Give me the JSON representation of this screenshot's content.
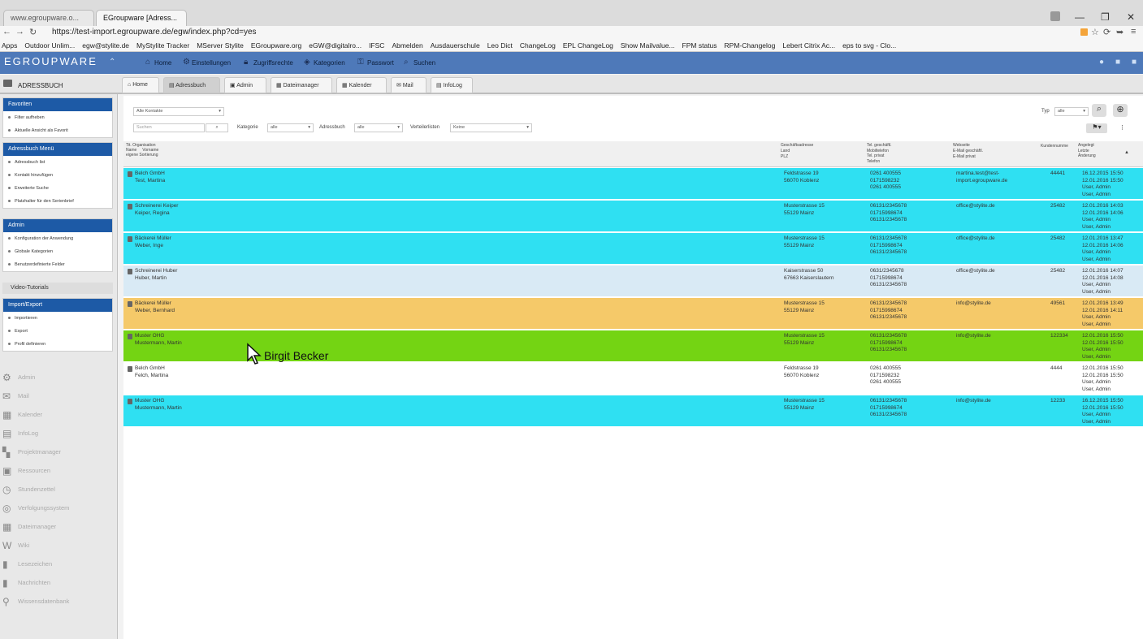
{
  "browser": {
    "tabs": [
      "www.egroupware.o...",
      "EGroupware [Adress..."
    ],
    "url": "https://test-import.egroupware.de/egw/index.php?cd=yes",
    "bookmarks": [
      "Apps",
      "Outdoor Unlim...",
      "egw@stylite.de",
      "MyStylite Tracker",
      "MServer Stylite",
      "EGroupware.org",
      "eGW@digitalro...",
      "IFSC",
      "Abmelden",
      "Ausdauerschule",
      "Leo Dict",
      "ChangeLog",
      "EPL ChangeLog",
      "Show Mailvalue...",
      "FPM status",
      "RPM-Changelog",
      "Lebert Citrix Ac...",
      "eps to svg - Clo..."
    ]
  },
  "topbar": {
    "logo": "EGROUPWARE",
    "nav": [
      "Home",
      "Einstellungen",
      "Zugriffsrechte",
      "Kategorien",
      "Passwort",
      "Suchen"
    ]
  },
  "app": {
    "title": "ADRESSBUCH",
    "tabs": [
      "Home",
      "Adressbuch",
      "Admin",
      "Dateimanager",
      "Kalender",
      "Mail",
      "InfoLog"
    ]
  },
  "sidebar": {
    "favoriten": {
      "header": "Favoriten",
      "items": [
        "Filter aufheben",
        "Aktuelle Ansicht als Favorit"
      ]
    },
    "menu": {
      "header": "Adressbuch Menü",
      "items": [
        "Adressbuch list",
        "Kontakt hinzufügen",
        "Erweiterte Suche",
        "Platzhalter für den Serienbrief"
      ]
    },
    "admin": {
      "header": "Admin",
      "items": [
        "Konfiguration der Anwendung",
        "Globale Kategorien",
        "Benutzerdefinierte Felder"
      ]
    },
    "video": "Video-Tutorials",
    "impexp": {
      "header": "Import/Export",
      "items": [
        "Importieren",
        "Export",
        "Profil definieren"
      ]
    },
    "apps": [
      "Admin",
      "Mail",
      "Kalender",
      "InfoLog",
      "Projektmanager",
      "Ressourcen",
      "Stundenzettel",
      "Verfolgungssystem",
      "Dateimanager",
      "Wiki",
      "Lesezeichen",
      "Nachrichten",
      "Wissensdatenbank"
    ]
  },
  "filters": {
    "view": "Alle Kontakte",
    "search_placeholder": "Suchen",
    "kategorie_label": "Kategorie",
    "kategorie_value": "alle",
    "adressbuch_label": "Adressbuch",
    "adressbuch_value": "alle",
    "verteiler_label": "Verteilerlisten",
    "verteiler_value": "Keine",
    "typ_label": "Typ",
    "typ_value": "alle"
  },
  "columns": {
    "name": "Tit. Organisation\nName     Vorname\neigene Sortierung",
    "address": "Geschäftsadresse\nLand\nPLZ",
    "phone": "Tel. geschäftl.\nMobiltelefon\nTel. privat\nTelefon",
    "web": "Webseite\nE-Mail geschäftl.\nE-Mail privat",
    "custno": "Kundennumme",
    "modified": "Angelegt\nLetzte\nÄnderung"
  },
  "colors": {
    "cyan": "#2fe0f2",
    "lightblue": "#d9eaf5",
    "orange": "#f5c969",
    "green": "#74d413",
    "white": "#ffffff"
  },
  "rows": [
    {
      "color": "cyan",
      "name": "Belch GmbH\nTest, Martina",
      "address": "Feldstrasse 19\n56070 Koblenz",
      "phone": "0261 400555\n0171598232\n0261 400555",
      "web": "martina.test@test-\nimport.egroupware.de",
      "custno": "44441",
      "modified": "16.12.2015 15:50\n12.01.2016 15:50\nUser, Admin\nUser, Admin"
    },
    {
      "color": "cyan",
      "name": "Schreinerei Keiper\nKeiper, Regina",
      "address": "Musterstrasse 15\n55129 Mainz",
      "phone": "06131/2345678\n01715998674\n06131/2345678",
      "web": "office@stylite.de",
      "custno": "25482",
      "modified": "12.01.2016 14:03\n12.01.2016 14:06\nUser, Admin\nUser, Admin"
    },
    {
      "color": "cyan",
      "name": "Bäckerei Müller\nWeber, Inge",
      "address": "Musterstrasse 15\n55129 Mainz",
      "phone": "06131/2345678\n01715998674\n06131/2345678",
      "web": "office@stylite.de",
      "custno": "25482",
      "modified": "12.01.2016 13:47\n12.01.2016 14:06\nUser, Admin\nUser, Admin"
    },
    {
      "color": "lightblue",
      "name": "Schreinerei Huber\nHuber, Martin",
      "address": "Kaiserstrasse 50\n67663 Kaiserslautern",
      "phone": "0631/2345678\n01715998674\n06131/2345678",
      "web": "office@stylite.de",
      "custno": "25482",
      "modified": "12.01.2016 14:07\n12.01.2016 14:08\nUser, Admin\nUser, Admin"
    },
    {
      "color": "orange",
      "name": "Bäckerei Müller\nWeber, Bernhard",
      "address": "Musterstrasse 15\n55129 Mainz",
      "phone": "06131/2345678\n01715998674\n06131/2345678",
      "web": "info@stylite.de",
      "custno": "49561",
      "modified": "12.01.2016 13:49\n12.01.2016 14:11\nUser, Admin\nUser, Admin"
    },
    {
      "color": "green",
      "name": "Muster OHG\nMustermann, Martin",
      "address": "Musterstrasse 15\n55129 Mainz",
      "phone": "06131/2345678\n01715998674\n06131/2345678",
      "web": "info@stylite.de",
      "custno": "122334",
      "modified": "12.01.2016 15:50\n12.01.2016 15:50\nUser, Admin\nUser, Admin"
    },
    {
      "color": "white",
      "name": "Belch GmbH\nFelch, Martina",
      "address": "Feldstrasse 19\n56070 Koblenz",
      "phone": "0261 400555\n0171598232\n0261 400555",
      "web": "",
      "custno": "4444",
      "modified": "12.01.2016 15:50\n12.01.2016 15:50\nUser, Admin\nUser, Admin"
    },
    {
      "color": "cyan",
      "name": "Muster OHG\nMustermann, Martin",
      "address": "Musterstrasse 15\n55129 Mainz",
      "phone": "06131/2345678\n01715998674\n06131/2345678",
      "web": "info@stylite.de",
      "custno": "12233",
      "modified": "16.12.2015 15:50\n12.01.2016 15:50\nUser, Admin\nUser, Admin"
    }
  ],
  "tooltip": "Birgit Becker"
}
